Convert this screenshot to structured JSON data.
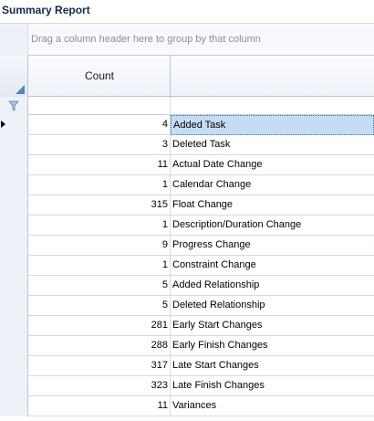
{
  "title": "Summary Report",
  "group_panel": {
    "text": "Drag a column header here to group by that column"
  },
  "columns": {
    "count": "Count",
    "description": ""
  },
  "rows": [
    {
      "count": "4",
      "description": "Added Task",
      "selected": true
    },
    {
      "count": "3",
      "description": "Deleted Task"
    },
    {
      "count": "11",
      "description": "Actual Date Change"
    },
    {
      "count": "1",
      "description": "Calendar Change"
    },
    {
      "count": "315",
      "description": "Float Change"
    },
    {
      "count": "1",
      "description": "Description/Duration Change"
    },
    {
      "count": "9",
      "description": "Progress Change"
    },
    {
      "count": "1",
      "description": "Constraint Change"
    },
    {
      "count": "5",
      "description": "Added Relationship"
    },
    {
      "count": "5",
      "description": "Deleted Relationship"
    },
    {
      "count": "281",
      "description": "Early Start Changes"
    },
    {
      "count": "288",
      "description": "Early Finish Changes"
    },
    {
      "count": "317",
      "description": "Late Start Changes"
    },
    {
      "count": "323",
      "description": "Late Finish Changes"
    },
    {
      "count": "11",
      "description": "Variances"
    }
  ],
  "colors": {
    "selection": "#c5dcf5",
    "accent": "#4f86c4",
    "title": "#0f2a4e"
  },
  "icons": {
    "filter": "filter-icon",
    "row_pointer": "current-row-arrow-icon"
  }
}
